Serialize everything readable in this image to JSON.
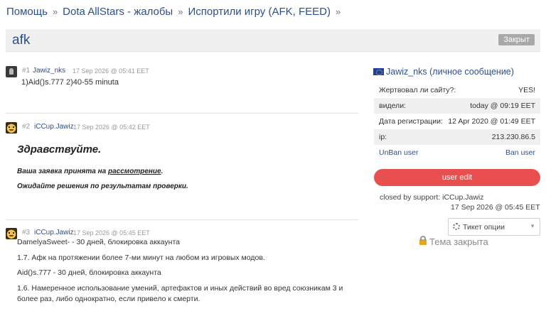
{
  "breadcrumb": {
    "items": [
      "Помощь",
      "Dota AllStars - жалобы",
      "Испортили игру (AFK, FEED)"
    ],
    "separator": "»"
  },
  "topic": {
    "title": "afk",
    "status": "Закрыт"
  },
  "posts": [
    {
      "num": "#1",
      "author": "Jawiz_nks",
      "date": "17 Sep 2026 @ 05:41 EET",
      "lines": [
        "1)Aid()s.777 2)40-55 minuta"
      ]
    },
    {
      "num": "#2",
      "author": "iCCup.Jawiz",
      "date": "17 Sep 2026 @ 05:42 EET",
      "greeting": "Здравствуйте.",
      "note1_prefix": "Ваша заявка принята на ",
      "note1_link": "рассмотрение",
      "note1_suffix": ".",
      "note2": "Ожидайте решения по результатам проверки."
    },
    {
      "num": "#3",
      "author": "iCCup.Jawiz",
      "date": "17 Sep 2026 @ 05:45 EET",
      "lines": [
        "DamelyaSweet- - 30 дней, блокировка аккаунта",
        "1.7. Афк на протяжении более 7-ми минут на любом из игровых модов.",
        "Aid()s.777 - 30 дней, блокировка аккаунта",
        "1.6. Намеренное использование умений, артефактов и иных действий во вред союзникам 3 и",
        "более раз, либо однократно, если привело к смерти."
      ]
    }
  ],
  "sidebar": {
    "username": "Jawiz_nks",
    "username_suffix": " (личное сообщение)",
    "info": [
      {
        "k": "Жертвовал ли сайту?:",
        "v": "YES!"
      },
      {
        "k": "видели:",
        "v": "today @ 09:19 EET"
      },
      {
        "k": "Дата регистрации:",
        "v": "12 Apr 2020 @ 01:49 EET"
      },
      {
        "k": "ip:",
        "v": "213.230.86.5"
      },
      {
        "k": "UnBan user",
        "v": "Ban user"
      }
    ],
    "edit_button": "user edit",
    "closed_by": "closed by support: iCCup.Jawiz",
    "closed_date": "17 Sep 2026 @ 05:45 EET",
    "ticket_options": "Тикет опции",
    "theme_closed": "Тема закрыта"
  },
  "colors": {
    "link": "#2b4f8e",
    "edit_button": "#e85050",
    "status_badge": "#a9a9a9"
  }
}
